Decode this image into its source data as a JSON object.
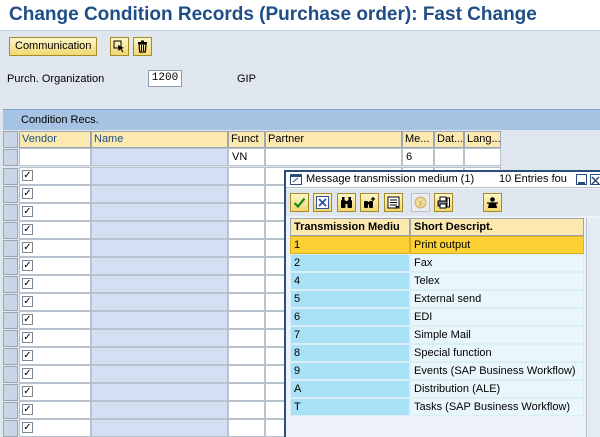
{
  "window": {
    "title": "Change Condition Records (Purchase order): Fast Change"
  },
  "toolbar": {
    "communication_label": "Communication"
  },
  "header_fields": {
    "purch_org_label": "Purch. Organization",
    "purch_org_value": "1200",
    "purch_org_desc": "GIP"
  },
  "table": {
    "caption": "Condition Recs.",
    "columns": [
      "Vendor",
      "Name",
      "Funct",
      "Partner",
      "Me...",
      "Dat...",
      "Lang..."
    ],
    "first_row": {
      "vendor": "",
      "name": "",
      "funct": "VN",
      "partner": "",
      "medium": "6",
      "date": "",
      "lang": ""
    },
    "checked_rows": 15
  },
  "dialog": {
    "title": "Message transmission medium (1)",
    "count": "10 Entries fou",
    "columns": [
      "Transmission Mediu",
      "Short Descript."
    ],
    "rows": [
      {
        "code": "1",
        "desc": "Print output",
        "selected": true
      },
      {
        "code": "2",
        "desc": "Fax"
      },
      {
        "code": "4",
        "desc": "Telex"
      },
      {
        "code": "5",
        "desc": "External send"
      },
      {
        "code": "6",
        "desc": "EDI"
      },
      {
        "code": "7",
        "desc": "Simple Mail"
      },
      {
        "code": "8",
        "desc": "Special function"
      },
      {
        "code": "9",
        "desc": "Events (SAP Business Workflow)"
      },
      {
        "code": "A",
        "desc": "Distribution (ALE)"
      },
      {
        "code": "T",
        "desc": "Tasks (SAP Business Workflow)"
      }
    ]
  }
}
